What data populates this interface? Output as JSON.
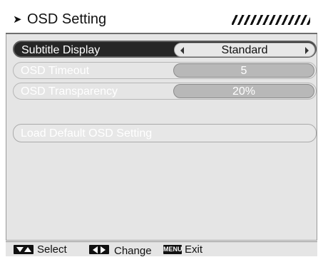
{
  "title": {
    "arrow_glyph": "➤",
    "text": "OSD Setting"
  },
  "menu": {
    "subtitle_display": {
      "label": "Subtitle Display",
      "value": "Standard"
    },
    "osd_timeout": {
      "label": "OSD Timeout",
      "value": "5"
    },
    "osd_transparency": {
      "label": "OSD Transparency",
      "value": "20%"
    },
    "load_default": {
      "label": "Load Default OSD Setting"
    }
  },
  "footer": {
    "select_label": "Select",
    "change_label": "Change",
    "menu_key": "MENU",
    "exit_label": "Exit"
  },
  "colors": {
    "selected_row": "#262626",
    "panel": "#e5e5e5",
    "value_dim": "#b8b8b8"
  },
  "icons": [
    "up-down-arrows-icon",
    "left-right-arrows-icon",
    "menu-key-icon",
    "left-arrow-icon",
    "right-arrow-icon"
  ]
}
